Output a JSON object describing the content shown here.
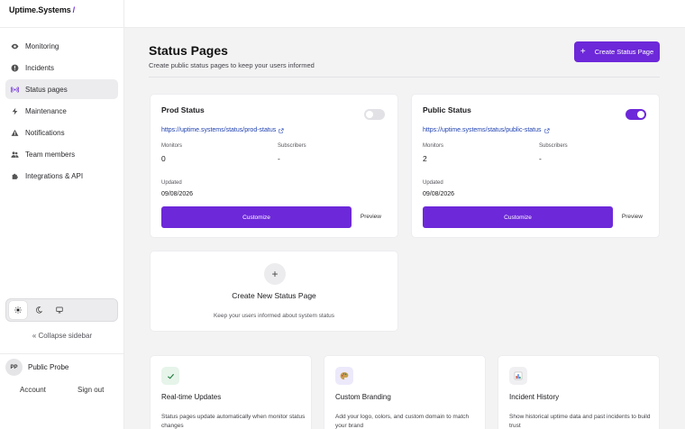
{
  "brand": {
    "name": "Uptime.Systems",
    "slash": "/"
  },
  "sidebar": {
    "items": [
      {
        "label": "Monitoring",
        "icon": "eye-icon"
      },
      {
        "label": "Incidents",
        "icon": "alert-circle-icon"
      },
      {
        "label": "Status pages",
        "icon": "broadcast-icon",
        "active": true
      },
      {
        "label": "Maintenance",
        "icon": "bolt-icon"
      },
      {
        "label": "Notifications",
        "icon": "warning-triangle-icon"
      },
      {
        "label": "Team members",
        "icon": "users-icon"
      },
      {
        "label": "Integrations & API",
        "icon": "puzzle-icon"
      }
    ],
    "theme": {
      "options": [
        "sun-icon",
        "moon-icon",
        "monitor-icon"
      ],
      "selected": "sun-icon"
    },
    "collapse_label": "« Collapse sidebar",
    "user": {
      "initials": "PP",
      "name": "Public Probe",
      "account_label": "Account",
      "signout_label": "Sign out"
    }
  },
  "header": {
    "title": "Status Pages",
    "subtitle": "Create public status pages to keep your users informed",
    "create_label": "Create Status Page"
  },
  "status_pages": [
    {
      "title": "Prod Status",
      "enabled": false,
      "url": "https://uptime.systems/status/prod-status",
      "monitors_label": "Monitors",
      "monitors": "0",
      "subscribers_label": "Subscribers",
      "subscribers": "-",
      "updated_label": "Updated",
      "updated": "09/08/2026",
      "customize_label": "Customize",
      "preview_label": "Preview"
    },
    {
      "title": "Public Status",
      "enabled": true,
      "url": "https://uptime.systems/status/public-status",
      "monitors_label": "Monitors",
      "monitors": "2",
      "subscribers_label": "Subscribers",
      "subscribers": "-",
      "updated_label": "Updated",
      "updated": "09/08/2026",
      "customize_label": "Customize",
      "preview_label": "Preview"
    }
  ],
  "new_card": {
    "title": "Create New Status Page",
    "subtitle": "Keep your users informed about system status"
  },
  "features": [
    {
      "title": "Real-time Updates",
      "description": "Status pages update automatically when monitor status changes",
      "icon": "check-icon",
      "bg": "#e6f4ea",
      "color": "#1e7a3c"
    },
    {
      "title": "Custom Branding",
      "description": "Add your logo, colors, and custom domain to match your brand",
      "icon": "palette-icon",
      "bg": "#ece9fb",
      "color": "#6d28d9"
    },
    {
      "title": "Incident History",
      "description": "Show historical uptime data and past incidents to build trust",
      "icon": "bar-chart-icon",
      "bg": "#f0f0f2",
      "color": "#c0392b"
    }
  ],
  "colors": {
    "accent": "#6d28d9",
    "link": "#1e40af"
  }
}
